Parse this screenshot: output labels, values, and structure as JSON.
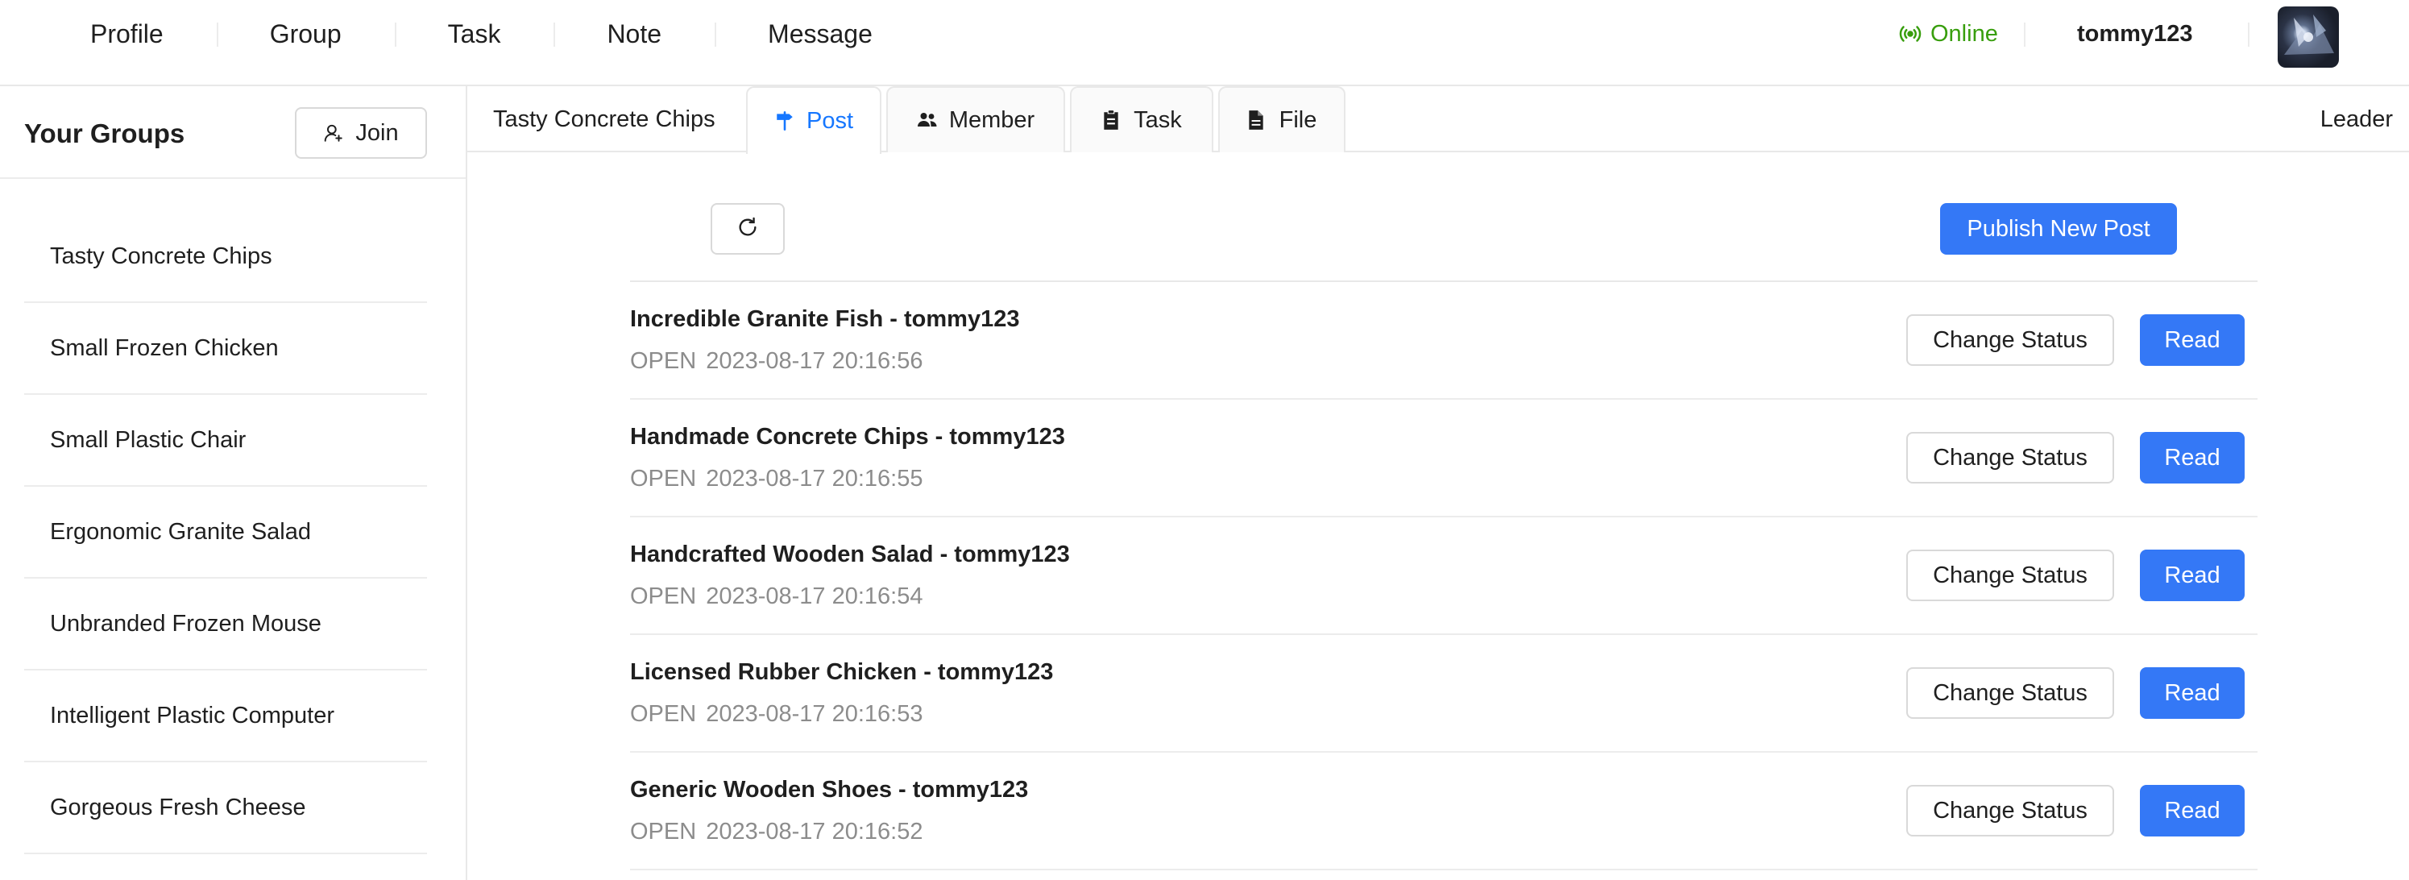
{
  "topnav": {
    "items": [
      "Profile",
      "Group",
      "Task",
      "Note",
      "Message"
    ]
  },
  "user": {
    "status": "Online",
    "status_icon": "broadcast-icon",
    "status_color": "#389e0d",
    "username": "tommy123"
  },
  "sidebar": {
    "title": "Your Groups",
    "join_label": "Join",
    "join_icon": "user-add-icon",
    "groups": [
      "Tasty Concrete Chips",
      "Small Frozen Chicken",
      "Small Plastic Chair",
      "Ergonomic Granite Salad",
      "Unbranded Frozen Mouse",
      "Intelligent Plastic Computer",
      "Gorgeous Fresh Cheese"
    ]
  },
  "tabs": {
    "group_name": "Tasty Concrete Chips",
    "items": [
      {
        "label": "Post",
        "icon": "signpost-icon",
        "active": true
      },
      {
        "label": "Member",
        "icon": "team-icon",
        "active": false
      },
      {
        "label": "Task",
        "icon": "clipboard-icon",
        "active": false
      },
      {
        "label": "File",
        "icon": "file-icon",
        "active": false
      }
    ],
    "role": "Leader"
  },
  "posts": {
    "refresh_icon": "refresh-icon",
    "publish_label": "Publish New Post",
    "change_status_label": "Change Status",
    "read_label": "Read",
    "items": [
      {
        "title": "Incredible Granite Fish - tommy123",
        "status": "OPEN",
        "date": "2023-08-17 20:16:56"
      },
      {
        "title": "Handmade Concrete Chips - tommy123",
        "status": "OPEN",
        "date": "2023-08-17 20:16:55"
      },
      {
        "title": "Handcrafted Wooden Salad - tommy123",
        "status": "OPEN",
        "date": "2023-08-17 20:16:54"
      },
      {
        "title": "Licensed Rubber Chicken - tommy123",
        "status": "OPEN",
        "date": "2023-08-17 20:16:53"
      },
      {
        "title": "Generic Wooden Shoes - tommy123",
        "status": "OPEN",
        "date": "2023-08-17 20:16:52"
      }
    ]
  },
  "colors": {
    "accent": "#3478f6",
    "tab_active_text": "#1677ff"
  }
}
